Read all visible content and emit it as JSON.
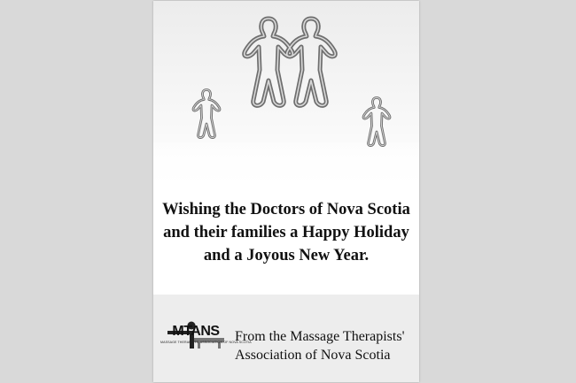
{
  "greeting": {
    "line1": "Wishing the Doctors of Nova Scotia",
    "line2": "and their families a Happy Holiday",
    "line3": "and a Joyous New Year."
  },
  "footer": {
    "logo_text": "MTANS",
    "logo_subtext": "MASSAGE THERAPISTS' ASSOCIATION OF NOVA SCOTIA",
    "from_line1": "From the Massage Therapists'",
    "from_line2": "Association of Nova Scotia"
  },
  "image": {
    "subject": "gingerbread-family-cookie-cutters"
  }
}
